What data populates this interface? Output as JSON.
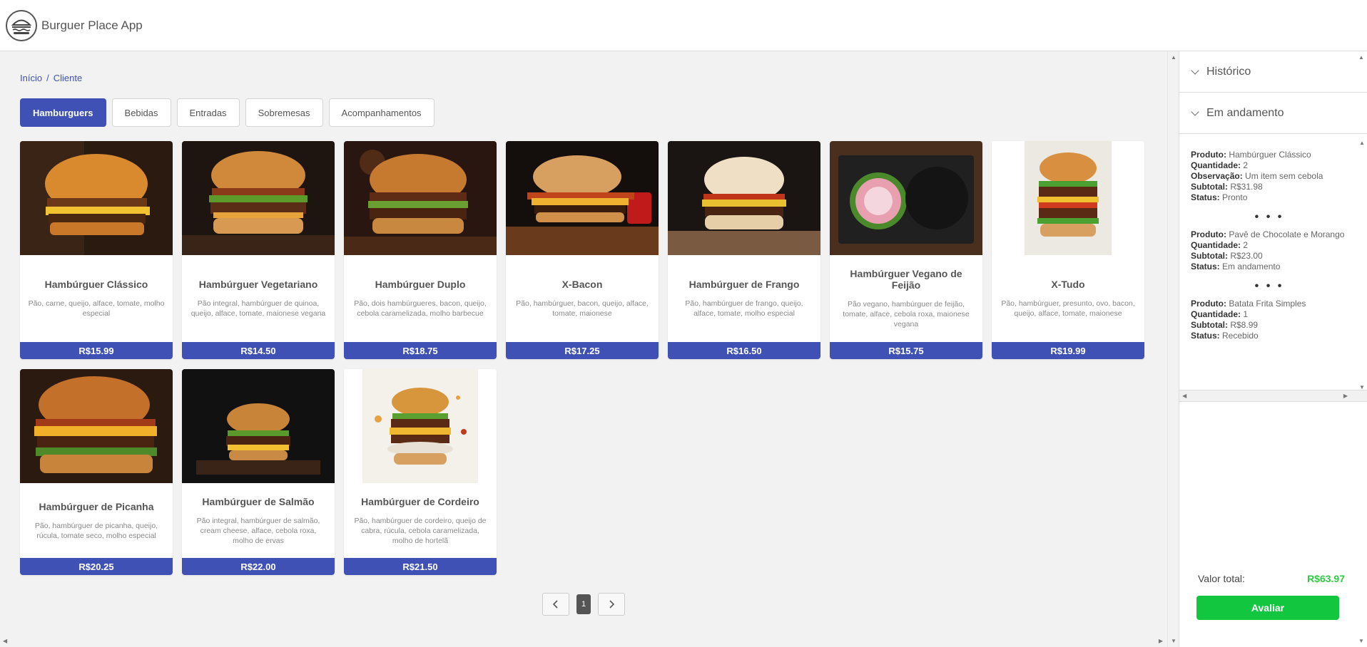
{
  "app": {
    "title": "Burguer Place App"
  },
  "breadcrumb": {
    "home": "Início",
    "separator": "/",
    "current": "Cliente"
  },
  "tabs": [
    {
      "label": "Hamburguers",
      "active": true
    },
    {
      "label": "Bebidas",
      "active": false
    },
    {
      "label": "Entradas",
      "active": false
    },
    {
      "label": "Sobremesas",
      "active": false
    },
    {
      "label": "Acompanhamentos",
      "active": false
    }
  ],
  "products": [
    {
      "name": "Hambúrguer Clássico",
      "description": "Pão, carne, queijo, alface, tomate, molho especial",
      "price": "R$15.99"
    },
    {
      "name": "Hambúrguer Vegetariano",
      "description": "Pão integral, hambúrguer de quinoa, queijo, alface, tomate, maionese vegana",
      "price": "R$14.50"
    },
    {
      "name": "Hambúrguer Duplo",
      "description": "Pão, dois hambúrgueres, bacon, queijo, cebola caramelizada, molho barbecue",
      "price": "R$18.75"
    },
    {
      "name": "X-Bacon",
      "description": "Pão, hambúrguer, bacon, queijo, alface, tomate, maionese",
      "price": "R$17.25"
    },
    {
      "name": "Hambúrguer de Frango",
      "description": "Pão, hambúrguer de frango, queijo, alface, tomate, molho especial",
      "price": "R$16.50"
    },
    {
      "name": "Hambúrguer Vegano de Feijão",
      "description": "Pão vegano, hambúrguer de feijão, tomate, alface, cebola roxa, maionese vegana",
      "price": "R$15.75"
    },
    {
      "name": "X-Tudo",
      "description": "Pão, hambúrguer, presunto, ovo, bacon, queijo, alface, tomate, maionese",
      "price": "R$19.99"
    },
    {
      "name": "Hambúrguer de Picanha",
      "description": "Pão, hambúrguer de picanha, queijo, rúcula, tomate seco, molho especial",
      "price": "R$20.25"
    },
    {
      "name": "Hambúrguer de Salmão",
      "description": "Pão integral, hambúrguer de salmão, cream cheese, alface, cebola roxa, molho de ervas",
      "price": "R$22.00"
    },
    {
      "name": "Hambúrguer de Cordeiro",
      "description": "Pão, hambúrguer de cordeiro, queijo de cabra, rúcula, cebola caramelizada, molho de hortelã",
      "price": "R$21.50"
    }
  ],
  "pagination": {
    "current_page": "1",
    "prev_icon": "chevron-left-icon",
    "next_icon": "chevron-right-icon"
  },
  "sidebar": {
    "history_label": "Histórico",
    "in_progress_label": "Em andamento",
    "labels": {
      "product": "Produto:",
      "quantity": "Quantidade:",
      "note": "Observação:",
      "subtotal": "Subtotal:",
      "status": "Status:"
    },
    "separator": "• • •",
    "orders": [
      {
        "product": "Hambúrguer Clássico",
        "quantity": "2",
        "note": "Um item sem cebola",
        "subtotal": "R$31.98",
        "status": "Pronto"
      },
      {
        "product": "Pavê de Chocolate e Morango",
        "quantity": "2",
        "subtotal": "R$23.00",
        "status": "Em andamento"
      },
      {
        "product": "Batata Frita Simples",
        "quantity": "1",
        "subtotal": "R$8.99",
        "status": "Recebido"
      }
    ],
    "total_label": "Valor total:",
    "total_value": "R$63.97",
    "rate_button": "Avaliar"
  },
  "colors": {
    "primary": "#3f51b5",
    "success": "#12c640",
    "total_text": "#2ecc40"
  }
}
